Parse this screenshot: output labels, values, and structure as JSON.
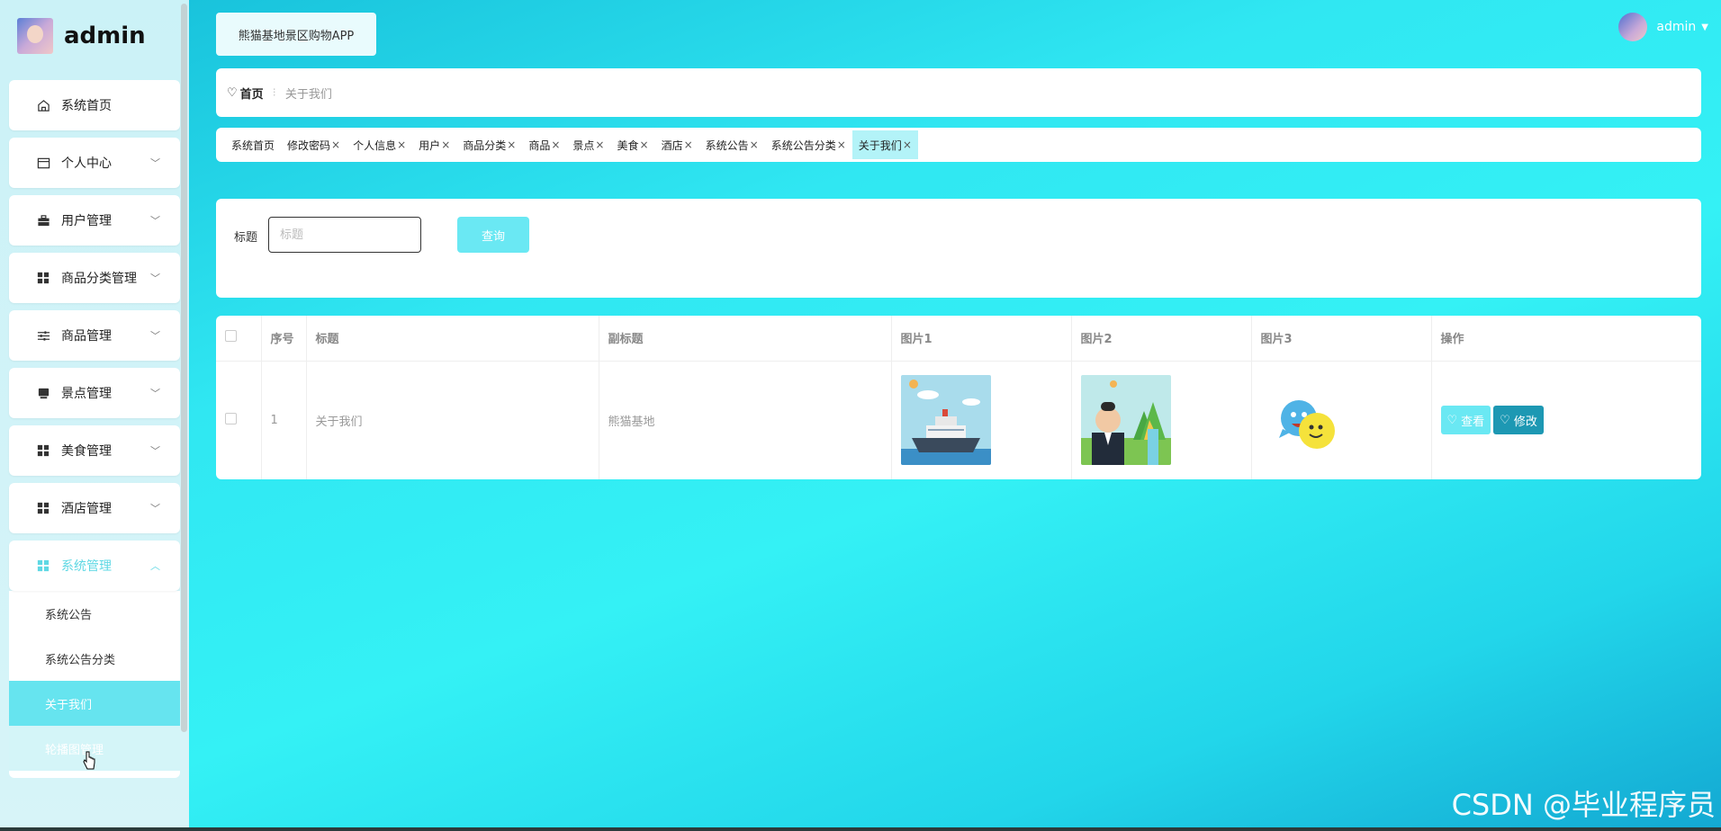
{
  "sidebar": {
    "title": "admin",
    "items": [
      {
        "label": "系统首页",
        "icon": "home-icon"
      },
      {
        "label": "个人中心",
        "icon": "card-icon"
      },
      {
        "label": "用户管理",
        "icon": "briefcase-icon"
      },
      {
        "label": "商品分类管理",
        "icon": "grid-icon"
      },
      {
        "label": "商品管理",
        "icon": "sliders-icon"
      },
      {
        "label": "景点管理",
        "icon": "monitor-icon"
      },
      {
        "label": "美食管理",
        "icon": "grid-icon"
      },
      {
        "label": "酒店管理",
        "icon": "grid-icon"
      },
      {
        "label": "系统管理",
        "icon": "grid-icon"
      }
    ],
    "sub_items": [
      "系统公告",
      "系统公告分类",
      "关于我们",
      "轮播图管理"
    ]
  },
  "header": {
    "app_tab": "熊猫基地景区购物APP",
    "user": "admin"
  },
  "breadcrumb": {
    "home": "首页",
    "current": "关于我们"
  },
  "tags": [
    "系统首页",
    "修改密码",
    "个人信息",
    "用户",
    "商品分类",
    "商品",
    "景点",
    "美食",
    "酒店",
    "系统公告",
    "系统公告分类",
    "关于我们"
  ],
  "search": {
    "label": "标题",
    "placeholder": "标题",
    "button": "查询"
  },
  "table": {
    "headers": [
      "序号",
      "标题",
      "副标题",
      "图片1",
      "图片2",
      "图片3",
      "操作"
    ],
    "rows": [
      {
        "index": "1",
        "title": "关于我们",
        "subtitle": "熊猫基地"
      }
    ],
    "view_label": "查看",
    "edit_label": "修改"
  },
  "watermark": "CSDN @毕业程序员",
  "colors": {
    "accent": "#6ae8f3",
    "edit": "#1d98b3",
    "active_sub": "#66e4ef"
  }
}
